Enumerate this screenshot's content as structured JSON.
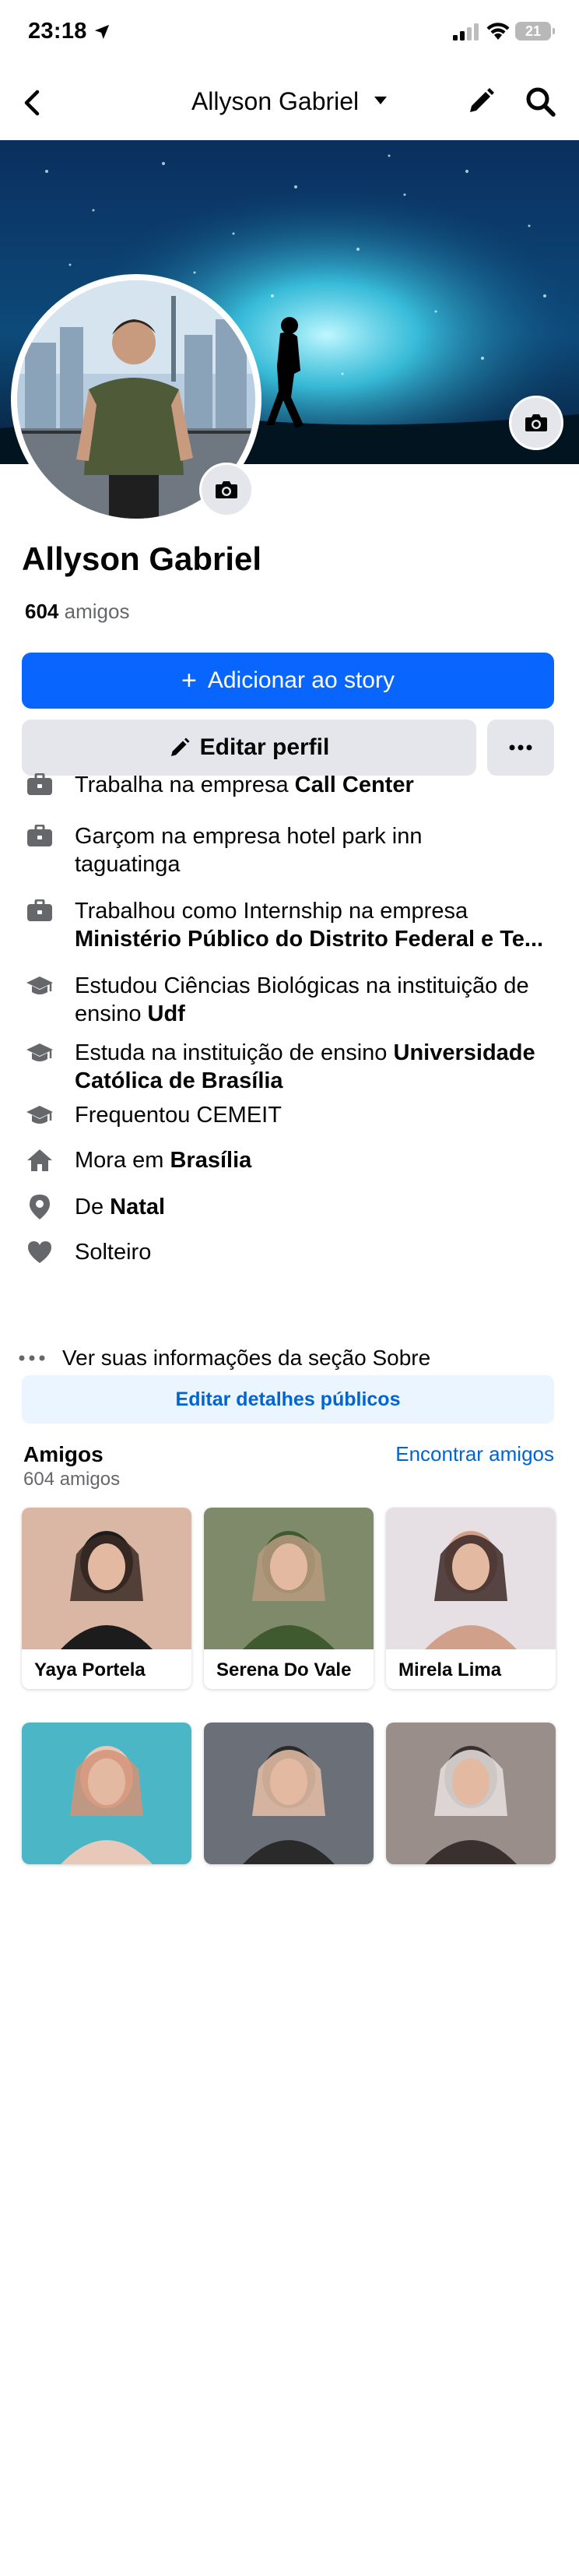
{
  "status": {
    "time": "23:18",
    "battery": "21"
  },
  "nav": {
    "title": "Allyson Gabriel"
  },
  "profile": {
    "name": "Allyson Gabriel",
    "friend_count": "604",
    "friend_count_suffix": "amigos"
  },
  "buttons": {
    "add_story": "Adicionar ao story",
    "edit_profile": "Editar perfil",
    "edit_public": "Editar detalhes públicos"
  },
  "details": [
    {
      "icon": "briefcase-icon",
      "lines": [
        {
          "text": "Trabalha na empresa ",
          "bold": "Call Center"
        }
      ]
    },
    {
      "icon": "briefcase-icon",
      "lines": [
        {
          "text": "Garçom na empresa hotel park inn",
          "bold": ""
        },
        {
          "text": "taguatinga",
          "bold": ""
        }
      ]
    },
    {
      "icon": "briefcase-icon",
      "lines": [
        {
          "text": "Trabalhou como Internship na empresa",
          "bold": ""
        },
        {
          "text": "",
          "bold": "Ministério Público do Distrito Federal e Te..."
        }
      ]
    },
    {
      "icon": "graduation-cap-icon",
      "lines": [
        {
          "text": "Estudou Ciências Biológicas na instituição de",
          "bold": ""
        },
        {
          "text": "ensino ",
          "bold": "Udf"
        }
      ]
    },
    {
      "icon": "graduation-cap-icon",
      "lines": [
        {
          "text": "Estuda na instituição de ensino ",
          "bold": "Universidade"
        },
        {
          "text": "",
          "bold": "Católica de Brasília"
        }
      ]
    },
    {
      "icon": "graduation-cap-icon",
      "lines": [
        {
          "text": "Frequentou CEMEIT",
          "bold": ""
        }
      ]
    },
    {
      "icon": "home-icon",
      "lines": [
        {
          "text": "Mora em ",
          "bold": "Brasília"
        }
      ]
    },
    {
      "icon": "location-pin-icon",
      "lines": [
        {
          "text": "De ",
          "bold": "Natal"
        }
      ]
    },
    {
      "icon": "heart-icon",
      "lines": [
        {
          "text": "Solteiro",
          "bold": ""
        }
      ]
    }
  ],
  "see_about": "Ver suas informações da seção Sobre",
  "friends": {
    "title": "Amigos",
    "subtitle": "604 amigos",
    "find_link": "Encontrar amigos",
    "cards": [
      {
        "name": "Yaya Portela"
      },
      {
        "name": "Serena Do Vale"
      },
      {
        "name": "Mirela Lima"
      },
      {
        "name": ""
      },
      {
        "name": ""
      },
      {
        "name": ""
      }
    ]
  },
  "colors": {
    "primary": "#0866ff",
    "link": "#0064d1",
    "secondary_button": "#e4e6eb",
    "public_button_bg": "#ebf5ff"
  }
}
